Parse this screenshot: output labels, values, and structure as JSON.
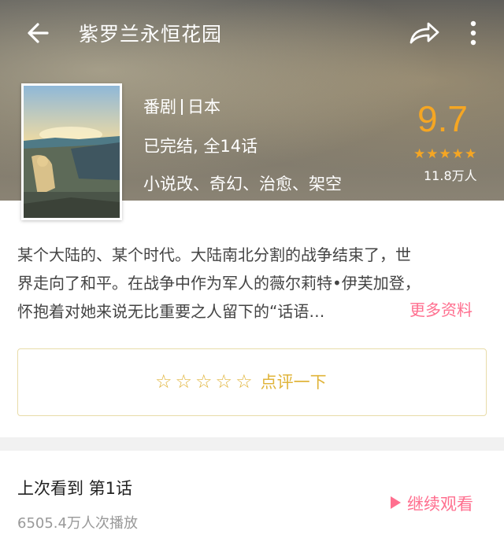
{
  "header": {
    "title": "紫罗兰永恒花园",
    "icons": [
      "back-arrow-icon",
      "share-icon",
      "more-vertical-icon"
    ]
  },
  "info": {
    "type": "番剧",
    "region": "日本",
    "status": "已完结, 全14话",
    "tags": "小说改、奇幻、治愈、架空"
  },
  "rating": {
    "score": "9.7",
    "stars": 5,
    "count": "11.8万人",
    "color": "#f5a623"
  },
  "description": {
    "lines": [
      "某个大陆的、某个时代。大陆南北分割的战争结束了，世",
      "界走向了和平。在战争中作为军人的薇尔莉特•伊芙加登，",
      "怀抱着对她来说无比重要之人留下的“话语…"
    ],
    "more_label": "更多资料",
    "accent_color": "#ff6f8f"
  },
  "review": {
    "label": "点评一下",
    "stars": 5,
    "color": "#e0b43a"
  },
  "progress": {
    "last_watched": "上次看到  第1话",
    "plays": "6505.4万人次播放",
    "continue_label": "继续观看"
  }
}
